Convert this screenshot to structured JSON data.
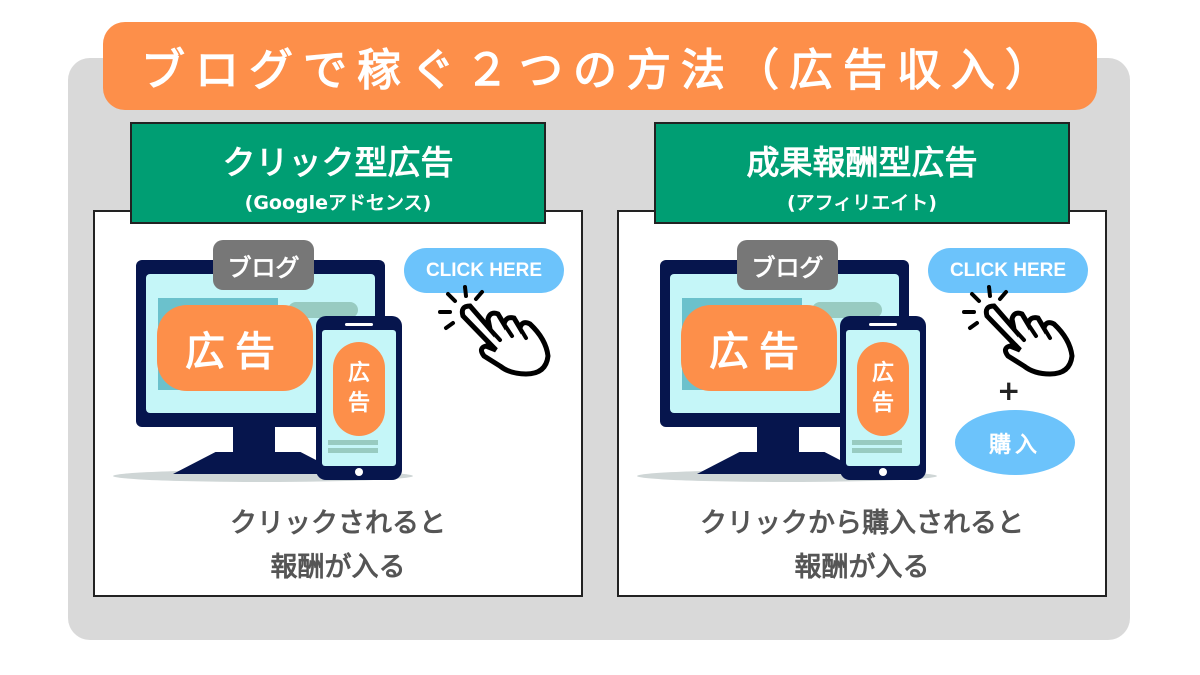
{
  "title": "ブログで稼ぐ２つの方法（広告収入）",
  "colors": {
    "title_bg": "#fd8f4a",
    "header_bg": "#009e73",
    "click_button": "#6cc3fb",
    "monitor": "#06154d",
    "panel": "#d9d9d9"
  },
  "cards": [
    {
      "heading": "クリック型広告",
      "subheading": "(Googleアドセンス)",
      "blog_label": "ブログ",
      "ad_label": "広告",
      "phone_ad": [
        "広",
        "告"
      ],
      "click_label": "CLICK HERE",
      "desc": [
        "クリックされると",
        "報酬が入る"
      ]
    },
    {
      "heading": "成果報酬型広告",
      "subheading": "(アフィリエイト)",
      "blog_label": "ブログ",
      "ad_label": "広告",
      "phone_ad": [
        "広",
        "告"
      ],
      "click_label": "CLICK HERE",
      "plus": "+",
      "buy_label": "購入",
      "desc": [
        "クリックから購入されると",
        "報酬が入る"
      ]
    }
  ]
}
